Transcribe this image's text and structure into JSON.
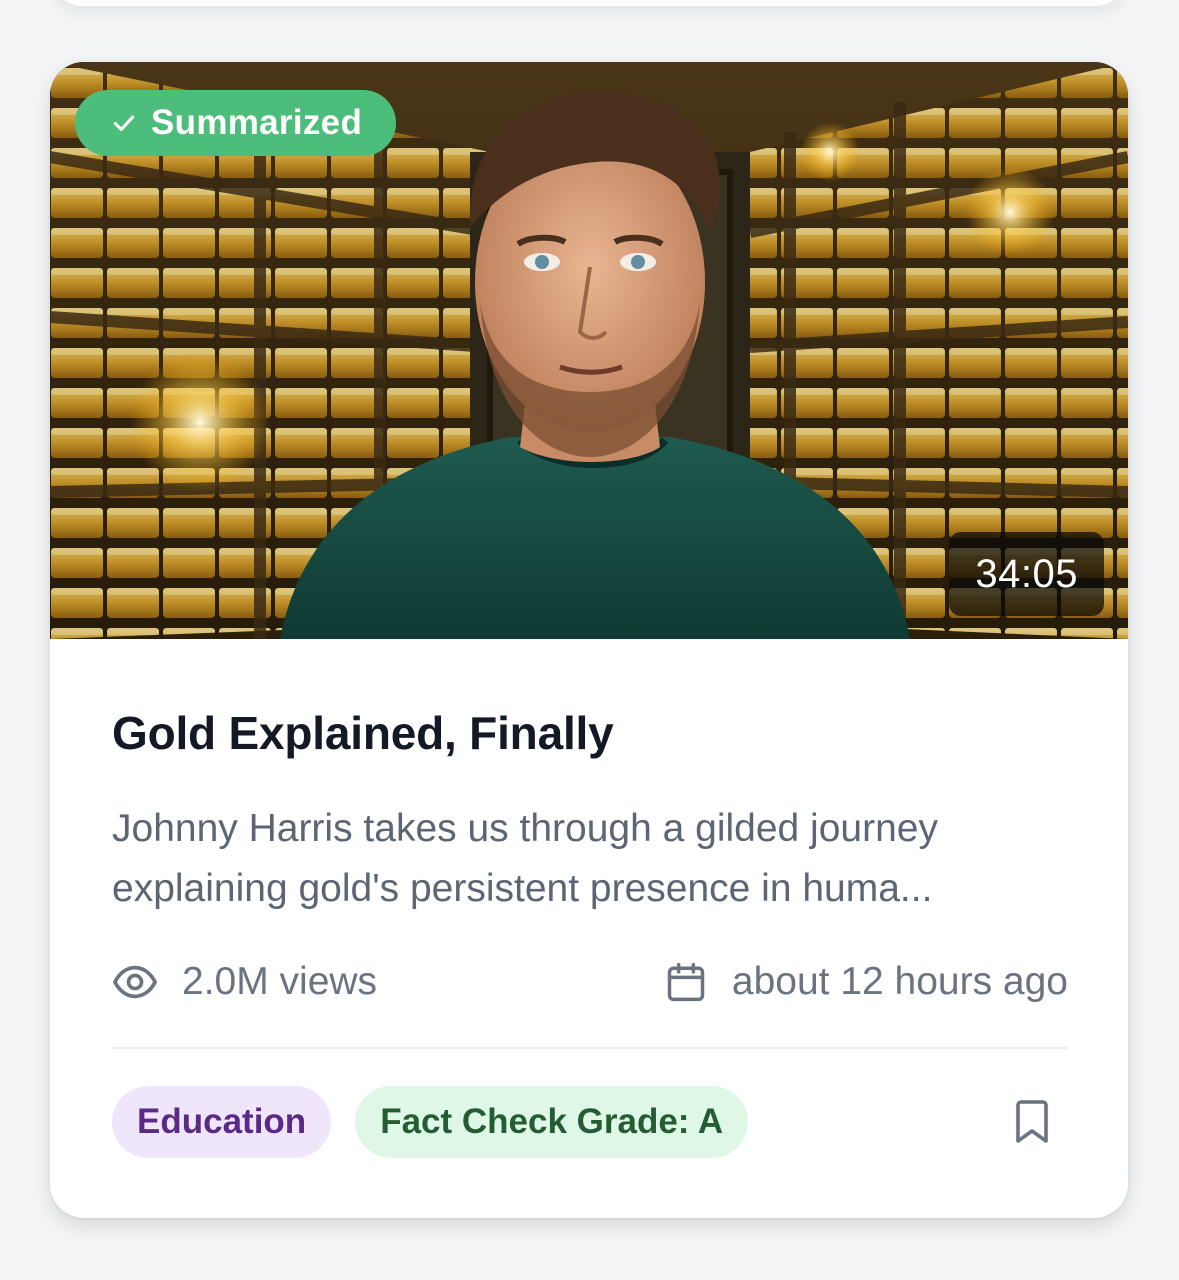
{
  "card": {
    "badge": {
      "label": "Summarized",
      "icon": "check-icon",
      "color": "#4dbd7c"
    },
    "duration": "34:05",
    "title": "Gold Explained, Finally",
    "description": "Johnny Harris takes us through a gilded journey explaining gold's persistent presence in huma...",
    "views": {
      "icon": "eye-icon",
      "text": "2.0M views"
    },
    "published": {
      "icon": "calendar-icon",
      "text": "about 12 hours ago"
    },
    "tags": [
      {
        "label": "Education",
        "color": "#5b2a86",
        "background": "#efe6fb"
      },
      {
        "label": "Fact Check Grade: A",
        "color": "#245c34",
        "background": "#def7e6"
      }
    ],
    "bookmark_icon": "bookmark-icon"
  }
}
